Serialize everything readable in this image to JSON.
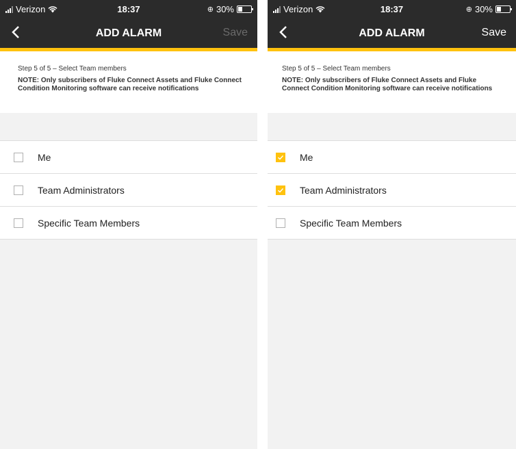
{
  "screens": [
    {
      "status": {
        "carrier": "Verizon",
        "time": "18:37",
        "battery": "30%"
      },
      "nav": {
        "back_icon": "chevron-left-icon",
        "title": "ADD ALARM",
        "save_label": "Save",
        "save_enabled": false
      },
      "info": {
        "step": "Step 5 of 5 – Select Team members",
        "note": "NOTE: Only subscribers of Fluke Connect Assets and Fluke Connect Condition Monitoring software can receive notifications"
      },
      "options": [
        {
          "label": "Me",
          "checked": false
        },
        {
          "label": "Team Administrators",
          "checked": false
        },
        {
          "label": "Specific Team Members",
          "checked": false
        }
      ]
    },
    {
      "status": {
        "carrier": "Verizon",
        "time": "18:37",
        "battery": "30%"
      },
      "nav": {
        "back_icon": "chevron-left-icon",
        "title": "ADD ALARM",
        "save_label": "Save",
        "save_enabled": true
      },
      "info": {
        "step": "Step 5 of 5 – Select Team members",
        "note": "NOTE: Only subscribers of Fluke Connect Assets and Fluke Connect Condition Monitoring software can receive notifications"
      },
      "options": [
        {
          "label": "Me",
          "checked": true
        },
        {
          "label": "Team Administrators",
          "checked": true
        },
        {
          "label": "Specific Team Members",
          "checked": false
        }
      ]
    }
  ],
  "colors": {
    "accent": "#ffc20e",
    "navbar": "#2b2b2b",
    "save_disabled": "#6b6b6b"
  }
}
